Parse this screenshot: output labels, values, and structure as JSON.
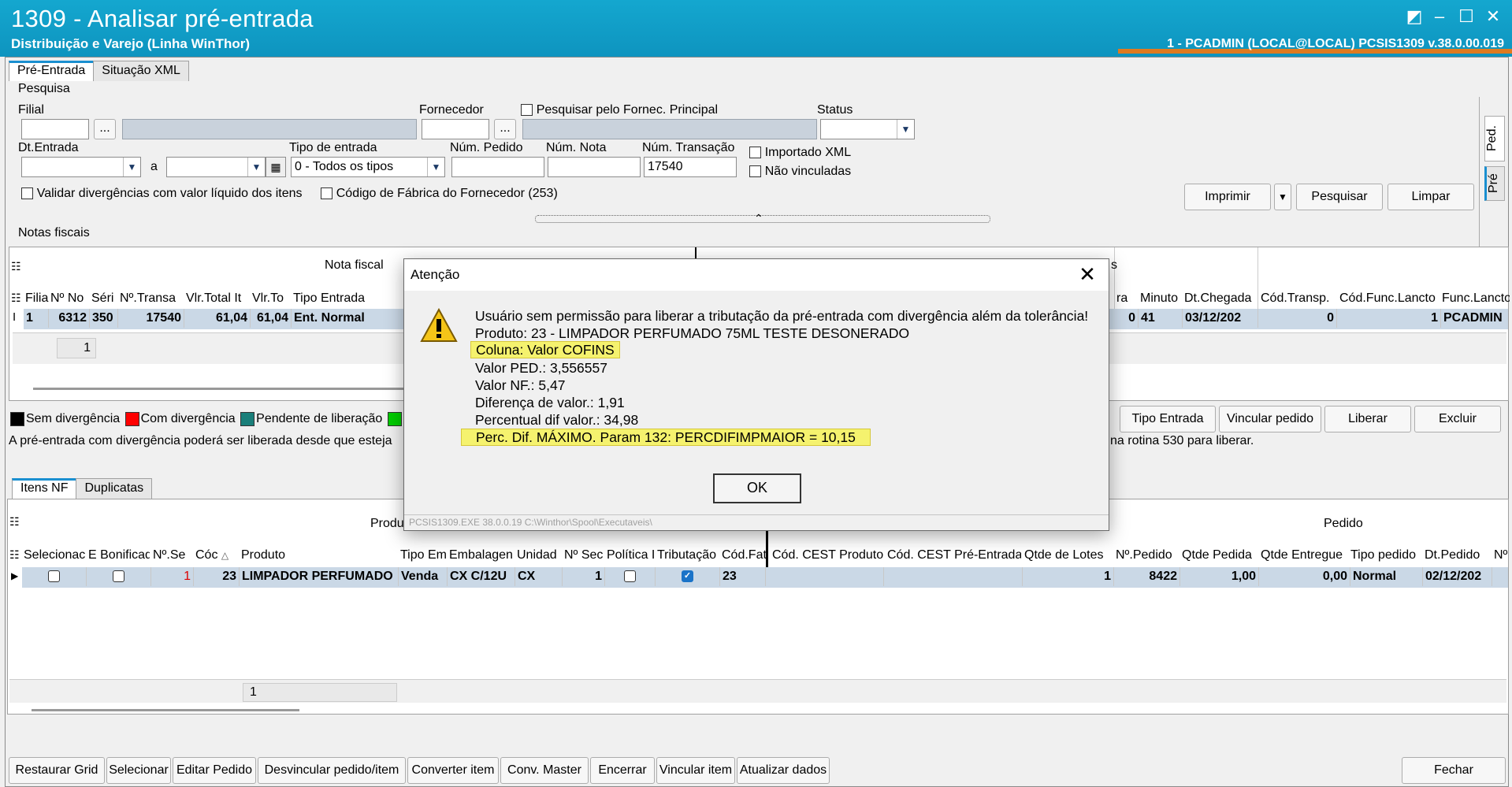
{
  "window": {
    "title": "1309 - Analisar pré-entrada",
    "subtitle": "Distribuição e Varejo (Linha WinThor)",
    "userinfo": "1 - PCADMIN (LOCAL@LOCAL)   PCSIS1309  v.38.0.00.019"
  },
  "top_tabs": [
    "Pré-Entrada",
    "Situação XML"
  ],
  "search": {
    "group_label": "Pesquisa",
    "filial_label": "Filial",
    "ellipsis": "...",
    "fornecedor_label": "Fornecedor",
    "fornec_principal_label": "Pesquisar pelo Fornec. Principal",
    "status_label": "Status",
    "dt_entrada_label": "Dt.Entrada",
    "a_label": "a",
    "tipo_entrada_label": "Tipo de entrada",
    "tipo_entrada_value": "0 - Todos os tipos",
    "num_pedido_label": "Núm. Pedido",
    "num_nota_label": "Núm. Nota",
    "num_transacao_label": "Núm. Transação",
    "num_transacao_value": "17540",
    "importado_xml_label": "Importado XML",
    "nao_vinculadas_label": "Não vinculadas",
    "validar_label": "Validar divergências com valor líquido dos itens",
    "cod_fabrica_label": "Código de Fábrica do Fornecedor (253)",
    "imprimir": "Imprimir",
    "pesquisar": "Pesquisar",
    "limpar": "Limpar",
    "side_tabs": [
      "Ped.",
      "Pré"
    ]
  },
  "notas": {
    "label": "Notas fiscais",
    "group_header": "Nota fiscal",
    "group_header_right": "s",
    "columns_left": [
      "Filia",
      "Nº No",
      "Séri",
      "Nº.Transa",
      "Vlr.Total It",
      "Vlr.To",
      "Tipo Entrada"
    ],
    "columns_right": [
      "ra",
      "Minuto",
      "Dt.Chegada",
      "Cód.Transp.",
      "Cód.Func.Lancto",
      "Func.Lancto"
    ],
    "row_left": [
      "1",
      "6312",
      "350",
      "17540",
      "61,04",
      "61,04",
      "Ent. Normal"
    ],
    "row_right": [
      "0",
      "41",
      "03/12/202",
      "0",
      "1",
      "PCADMIN"
    ],
    "footer_count": "1",
    "legend": [
      "Sem divergência",
      "Com divergência",
      "Pendente de liberação"
    ],
    "legend_colors": [
      "#000000",
      "#ff0000",
      "#1a7f7a",
      "#00cc00"
    ],
    "info_left": "A pré-entrada com divergência poderá ser liberada desde que esteja",
    "info_right": "na rotina 530 para liberar.",
    "buttons": [
      "Tipo Entrada",
      "Vincular pedido",
      "Liberar",
      "Excluir"
    ]
  },
  "items_tabs": [
    "Itens NF",
    "Duplicatas"
  ],
  "itens": {
    "group_produto": "Produt",
    "group_pedido": "Pedido",
    "columns": [
      "Selecionac",
      "E Bonificad",
      "Nº.Se",
      "Cóc",
      "Produto",
      "Tipo Em",
      "Embalagen",
      "Unidad",
      "Nº Sec",
      "Política I",
      "Tributação",
      "Cód.Fat",
      "Cód. CEST Produto",
      "Cód. CEST Pré-Entrada",
      "Qtde de Lotes",
      "Nº.Pedido",
      "Qtde Pedida",
      "Qtde Entregue",
      "Tipo pedido",
      "Dt.Pedido",
      "Nº"
    ],
    "row": [
      "",
      "",
      "1",
      "23",
      "LIMPADOR PERFUMADO",
      "Venda",
      "CX C/12U",
      "CX",
      "1",
      "",
      "",
      "23",
      "",
      "",
      "1",
      "8422",
      "1,00",
      "0,00",
      "Normal",
      "02/12/202",
      ""
    ],
    "footer_count": "1"
  },
  "bottom_buttons": [
    "Restaurar Grid",
    "Selecionar",
    "Editar Pedido",
    "Desvincular pedido/item",
    "Converter item",
    "Conv. Master",
    "Encerrar",
    "Vincular item",
    "Atualizar dados"
  ],
  "fechar": "Fechar",
  "dialog": {
    "title": "Atenção",
    "close": "✕",
    "lines": [
      "Usuário sem permissão para liberar a tributação da pré-entrada com divergência além da tolerância!",
      "Produto: 23 - LIMPADOR PERFUMADO 75ML TESTE DESONERADO",
      "Coluna: Valor COFINS",
      "Valor PED.: 3,556557",
      "Valor NF.: 5,47",
      "Diferença de valor.: 1,91",
      "Percentual dif valor.: 34,98",
      "Perc. Dif. MÁXIMO. Param 132: PERCDIFIMPMAIOR = 10,15"
    ],
    "ok": "OK",
    "footer": "PCSIS1309.EXE 38.0.0.19 C:\\Winthor\\Spool\\Executaveis\\"
  }
}
